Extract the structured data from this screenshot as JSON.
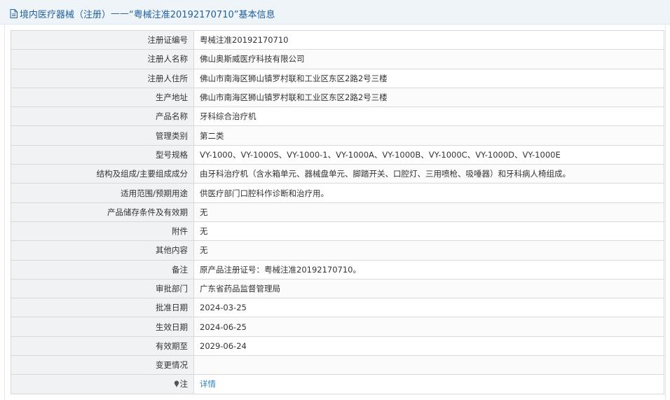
{
  "header": {
    "prefix": "境内医疗器械（注册）",
    "separator": " —— ",
    "title": "“粤械注准20192170710”基本信息"
  },
  "rows": [
    {
      "label": "注册证编号",
      "value": "粤械注准20192170710"
    },
    {
      "label": "注册人名称",
      "value": "佛山奥斯威医疗科技有限公司"
    },
    {
      "label": "注册人住所",
      "value": "佛山市南海区狮山镇罗村联和工业区东区2路2号三楼"
    },
    {
      "label": "生产地址",
      "value": "佛山市南海区狮山镇罗村联和工业区东区2路2号三楼"
    },
    {
      "label": "产品名称",
      "value": "牙科综合治疗机"
    },
    {
      "label": "管理类别",
      "value": "第二类"
    },
    {
      "label": "型号规格",
      "value": "VY-1000、VY-1000S、VY-1000-1、VY-1000A、VY-1000B、VY-1000C、VY-1000D、VY-1000E"
    },
    {
      "label": "结构及组成/主要组成成分",
      "value": "由牙科治疗机（含水箱单元、器械盘单元、脚踏开关、口腔灯、三用喷枪、吸唾器）和牙科病人椅组成。"
    },
    {
      "label": "适用范围/预期用途",
      "value": "供医疗部门口腔科作诊断和治疗用。"
    },
    {
      "label": "产品储存条件及有效期",
      "value": "无"
    },
    {
      "label": "附件",
      "value": "无"
    },
    {
      "label": "其他内容",
      "value": "无"
    },
    {
      "label": "备注",
      "value": "原产品注册证号：粤械注准20192170710。"
    },
    {
      "label": "审批部门",
      "value": "广东省药品监督管理局"
    },
    {
      "label": "批准日期",
      "value": "2024-03-25"
    },
    {
      "label": "生效日期",
      "value": "2024-06-25"
    },
    {
      "label": "有效期至",
      "value": "2029-06-24"
    },
    {
      "label": "变更情况",
      "value": ""
    }
  ],
  "note": {
    "label": "注",
    "link_text": "详情"
  },
  "colors": {
    "header_text": "#1f5f9c",
    "link": "#2f7fc1",
    "label_bg": "#f0f2f4",
    "border": "#d9d9d9"
  },
  "icons": {
    "header": "document-icon",
    "note": "pin-icon"
  }
}
